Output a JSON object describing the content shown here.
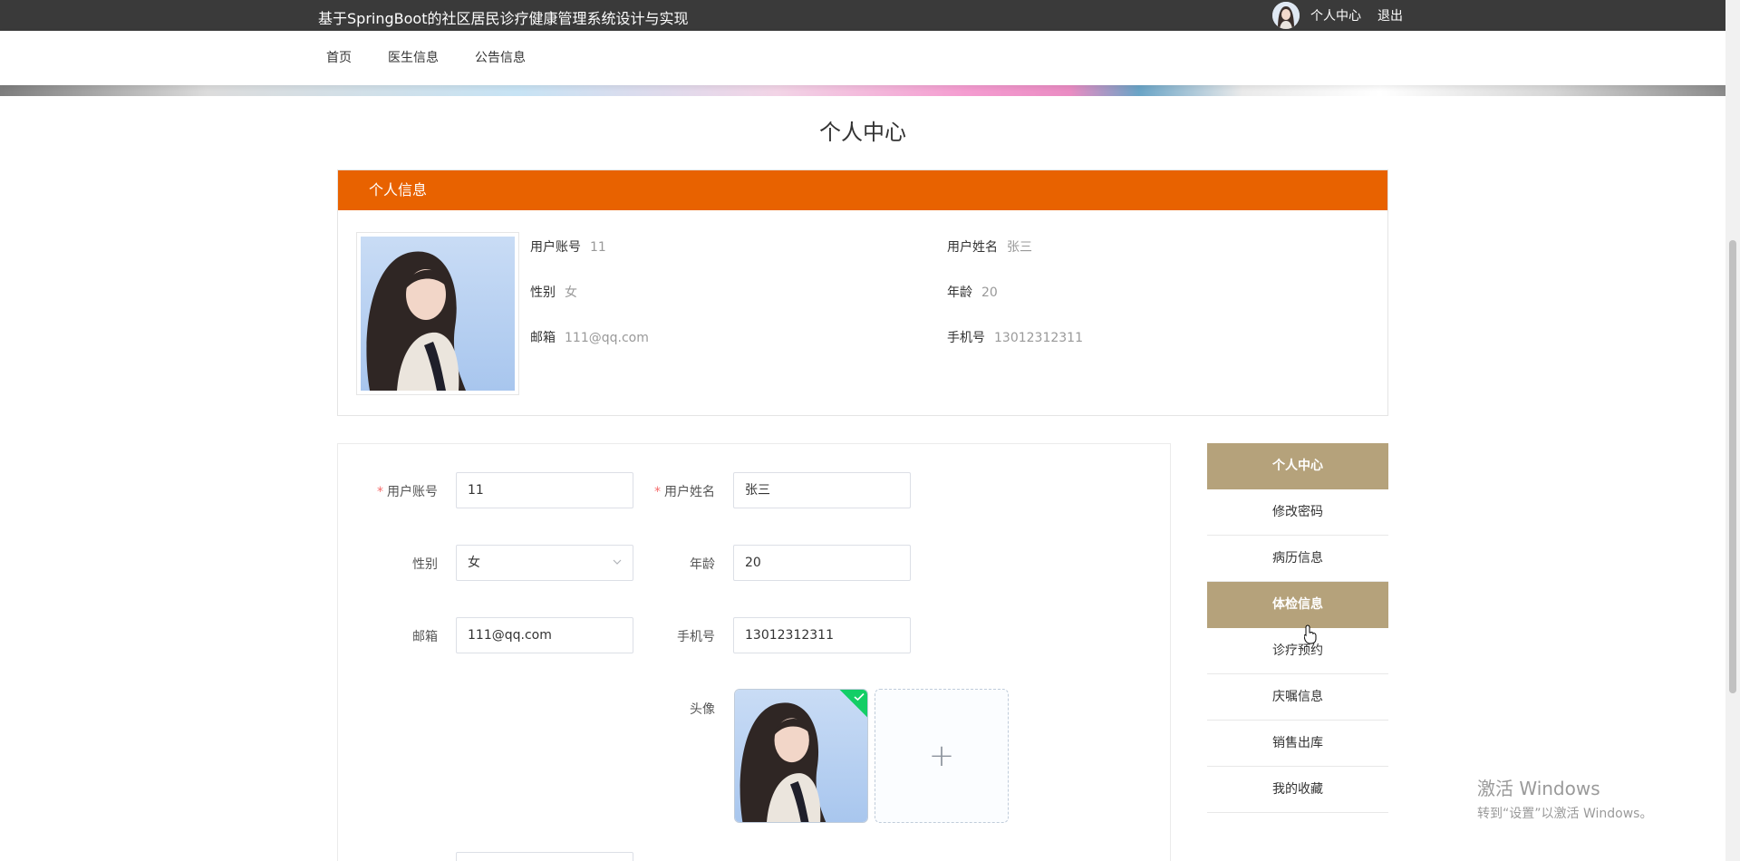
{
  "header": {
    "site_title": "基于SpringBoot的社区居民诊疗健康管理系统设计与实现",
    "user_center": "个人中心",
    "logout": "退出"
  },
  "nav": {
    "items": [
      "首页",
      "医生信息",
      "公告信息"
    ]
  },
  "page": {
    "title": "个人中心"
  },
  "info": {
    "header": "个人信息",
    "fields": [
      {
        "label": "用户账号",
        "value": "11"
      },
      {
        "label": "用户姓名",
        "value": "张三"
      },
      {
        "label": "性别",
        "value": "女"
      },
      {
        "label": "年龄",
        "value": "20"
      },
      {
        "label": "邮箱",
        "value": "111@qq.com"
      },
      {
        "label": "手机号",
        "value": "13012312311"
      }
    ]
  },
  "form": {
    "required_mark": "*",
    "account": {
      "label": "用户账号",
      "value": "11"
    },
    "name": {
      "label": "用户姓名",
      "value": "张三"
    },
    "gender": {
      "label": "性别",
      "value": "女"
    },
    "age": {
      "label": "年龄",
      "value": "20"
    },
    "email": {
      "label": "邮箱",
      "value": "111@qq.com"
    },
    "phone": {
      "label": "手机号",
      "value": "13012312311"
    },
    "avatar_label": "头像",
    "upload_plus": "+"
  },
  "side_menu": {
    "items": [
      "个人中心",
      "修改密码",
      "病历信息",
      "体检信息",
      "诊疗预约",
      "庆嘱信息",
      "销售出库",
      "我的收藏"
    ],
    "active": [
      "个人中心",
      "体检信息"
    ]
  },
  "watermark": {
    "line1": "激活 Windows",
    "line2": "转到“设置”以激活 Windows。"
  },
  "colors": {
    "accent_orange": "#e86200",
    "menu_active": "#b5a27b",
    "topbar": "#3a3a3a"
  },
  "icons": [
    "avatar-mini",
    "chevron-down-icon",
    "upload-success-check-icon",
    "plus-icon",
    "pointer-cursor-icon"
  ]
}
